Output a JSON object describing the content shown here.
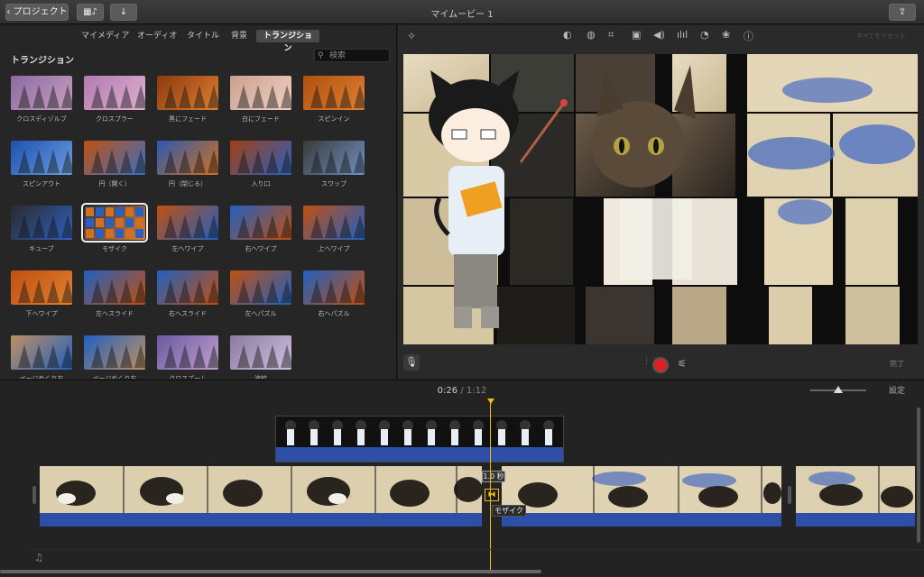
{
  "toolbar": {
    "back_label": "プロジェクト",
    "title": "マイムービー 1"
  },
  "browser": {
    "tabs": [
      "マイメディア",
      "オーディオ",
      "タイトル",
      "背景",
      "トランジション"
    ],
    "selected_tab": "トランジション",
    "section_title": "トランジション",
    "search_placeholder": "検索",
    "transitions": [
      "クロスディゾルブ",
      "クロスブラー",
      "黒にフェード",
      "白にフェード",
      "スピンイン",
      "スピンアウト",
      "円（開く）",
      "円（閉じる）",
      "入り口",
      "スワップ",
      "キューブ",
      "モザイク",
      "左へワイプ",
      "右へワイプ",
      "上へワイプ",
      "下へワイプ",
      "左へスライド",
      "右へスライド",
      "左へパズル",
      "右へパズル",
      "ページめくり左",
      "ページめくり右",
      "クロスズーム",
      "波紋"
    ],
    "selected_transition": "モザイク"
  },
  "viewer": {
    "reset_label": "すべてをリセット",
    "done_label": "完了",
    "tools": [
      "magic-wand-icon",
      "color-balance-icon",
      "color-correction-icon",
      "crop-icon",
      "stabilization-icon",
      "volume-icon",
      "noise-reduction-icon",
      "speed-icon",
      "clip-filter-icon",
      "info-icon"
    ]
  },
  "timeline": {
    "current_time": "0:26",
    "separator": "/",
    "total_time": "1:12",
    "settings_label": "設定",
    "transition_duration": "1.0 秒",
    "transition_name": "モザイク",
    "zoom_level": 0.5
  },
  "colors": {
    "accent": "#f0c000",
    "audio": "#2e4fa8",
    "record": "#e02020"
  }
}
